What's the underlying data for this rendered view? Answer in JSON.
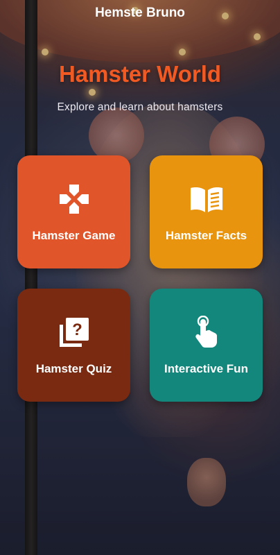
{
  "header": {
    "title": "Hemste Bruno"
  },
  "hero": {
    "title": "Hamster World",
    "subtitle": "Explore and learn about hamsters"
  },
  "colors": {
    "title_accent": "#f25a23",
    "game_card": "#e0552a",
    "facts_card": "#e8940e",
    "quiz_card": "#7a2a10",
    "fun_card": "#13877b"
  },
  "cards": [
    {
      "label": "Hamster Game",
      "icon": "gamepad-cross-icon"
    },
    {
      "label": "Hamster Facts",
      "icon": "open-book-icon"
    },
    {
      "label": "Hamster Quiz",
      "icon": "quiz-question-icon"
    },
    {
      "label": "Interactive Fun",
      "icon": "touch-hand-icon"
    }
  ]
}
